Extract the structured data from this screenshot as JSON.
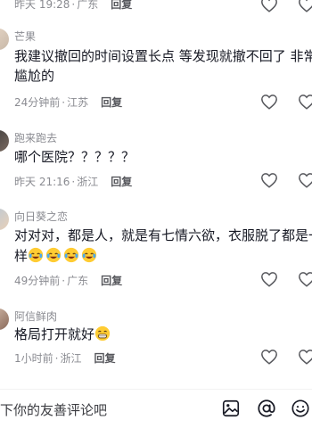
{
  "comments": [
    {
      "username": "",
      "text_lines": [],
      "time": "昨天 19:28",
      "location": "广东",
      "reply": "回复"
    },
    {
      "username": "芒果",
      "text_lines": [
        "我建议撤回的时间设置长点 等发现就撤不回了 非常",
        "尴尬的"
      ],
      "time": "24分钟前",
      "location": "江苏",
      "reply": "回复"
    },
    {
      "username": "跑来跑去",
      "text_lines": [
        "哪个医院？？？？？"
      ],
      "time": "昨天 21:16",
      "location": "浙江",
      "reply": "回复"
    },
    {
      "username": "向日葵之恋",
      "text_lines": [
        "对对对，都是人，就是有七情六欲，衣服脱了都是一",
        "样"
      ],
      "emojis_after_text": [
        "crying-laughing-emoji",
        "crying-laughing-emoji",
        "crying-laughing-emoji",
        "crying-laughing-emoji"
      ],
      "time": "49分钟前",
      "location": "广东",
      "reply": "回复"
    },
    {
      "username": "阿信鲜肉",
      "text_lines": [
        "格局打开就好"
      ],
      "emojis_after_text": [
        "grinning-emoji"
      ],
      "time": "1小时前",
      "location": "浙江",
      "reply": "回复"
    }
  ],
  "bottom_bar": {
    "placeholder": "下你的友善评论吧",
    "icons": [
      "image-icon",
      "at-icon",
      "emoji-icon"
    ]
  },
  "colors": {
    "text": "#161823",
    "secondary": "#8a8b91",
    "reply": "#56575c",
    "background": "#ffffff"
  },
  "separator": "·"
}
